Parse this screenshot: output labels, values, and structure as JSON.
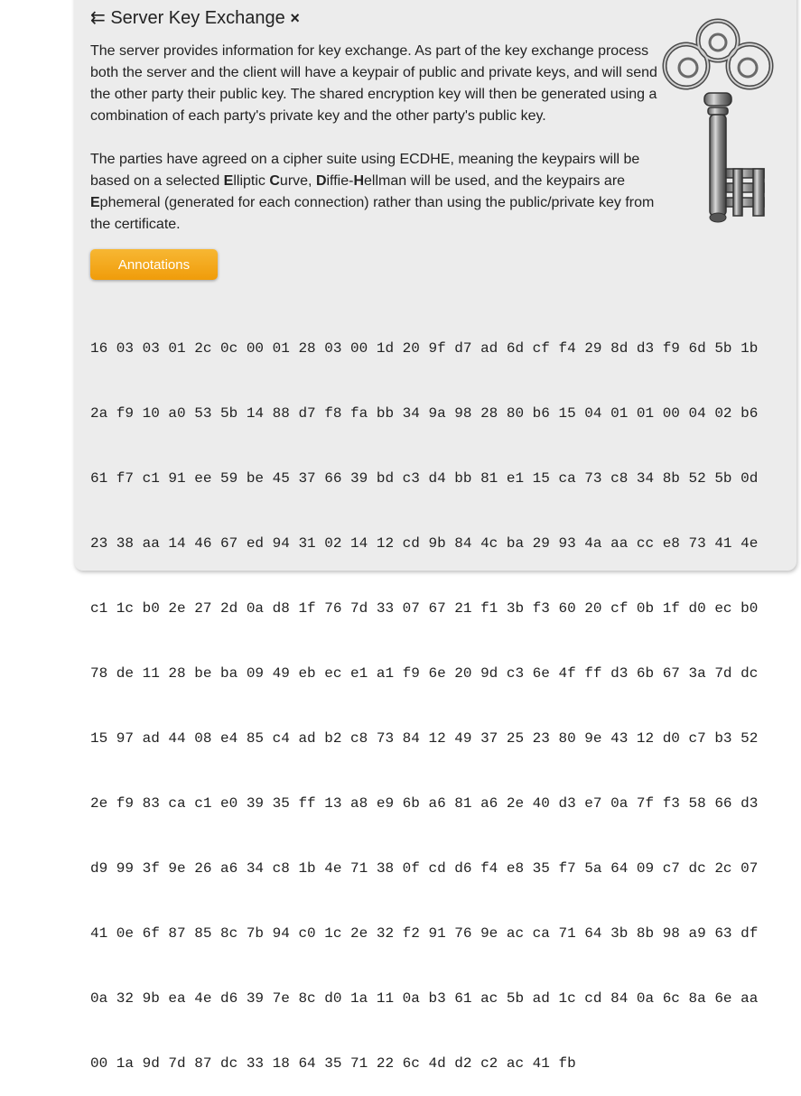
{
  "section": {
    "arrow_glyph": "⇇",
    "title": "Server Key Exchange",
    "close_glyph": "×"
  },
  "description": {
    "p1": "The server provides information for key exchange. As part of the key exchange process both the server and the client will have a keypair of public and private keys, and will send the other party their public key. The shared encryption key will then be generated using a combination of each party's private key and the other party's public key.",
    "p2_a": "The parties have agreed on a cipher suite using ECDHE, meaning the keypairs will be based on a selected ",
    "p2_E1": "E",
    "p2_b": "lliptic ",
    "p2_C": "C",
    "p2_c": "urve, ",
    "p2_D": "D",
    "p2_d": "iffie-",
    "p2_H": "H",
    "p2_e": "ellman will be used, and the keypairs are ",
    "p2_E2": "E",
    "p2_f": "phemeral (generated for each connection) rather than using the public/private key from the certificate."
  },
  "annotations_button": "Annotations",
  "hex_lines": [
    "16 03 03 01 2c 0c 00 01 28 03 00 1d 20 9f d7 ad 6d cf f4 29 8d d3 f9 6d 5b 1b",
    "2a f9 10 a0 53 5b 14 88 d7 f8 fa bb 34 9a 98 28 80 b6 15 04 01 01 00 04 02 b6",
    "61 f7 c1 91 ee 59 be 45 37 66 39 bd c3 d4 bb 81 e1 15 ca 73 c8 34 8b 52 5b 0d",
    "23 38 aa 14 46 67 ed 94 31 02 14 12 cd 9b 84 4c ba 29 93 4a aa cc e8 73 41 4e",
    "c1 1c b0 2e 27 2d 0a d8 1f 76 7d 33 07 67 21 f1 3b f3 60 20 cf 0b 1f d0 ec b0",
    "78 de 11 28 be ba 09 49 eb ec e1 a1 f9 6e 20 9d c3 6e 4f ff d3 6b 67 3a 7d dc",
    "15 97 ad 44 08 e4 85 c4 ad b2 c8 73 84 12 49 37 25 23 80 9e 43 12 d0 c7 b3 52",
    "2e f9 83 ca c1 e0 39 35 ff 13 a8 e9 6b a6 81 a6 2e 40 d3 e7 0a 7f f3 58 66 d3",
    "d9 99 3f 9e 26 a6 34 c8 1b 4e 71 38 0f cd d6 f4 e8 35 f7 5a 64 09 c7 dc 2c 07",
    "41 0e 6f 87 85 8c 7b 94 c0 1c 2e 32 f2 91 76 9e ac ca 71 64 3b 8b 98 a9 63 df",
    "0a 32 9b ea 4e d6 39 7e 8c d0 1a 11 0a b3 61 ac 5b ad 1c cd 84 0a 6c 8a 6e aa",
    "00 1a 9d 7d 87 dc 33 18 64 35 71 22 6c 4d d2 c2 ac 41 fb"
  ],
  "colors": {
    "card_bg": "#ececec",
    "button": "#f5a623",
    "text": "#222222"
  },
  "icons": {
    "key": "key-icon",
    "arrow": "double-left-arrow-icon",
    "close": "close-icon"
  }
}
